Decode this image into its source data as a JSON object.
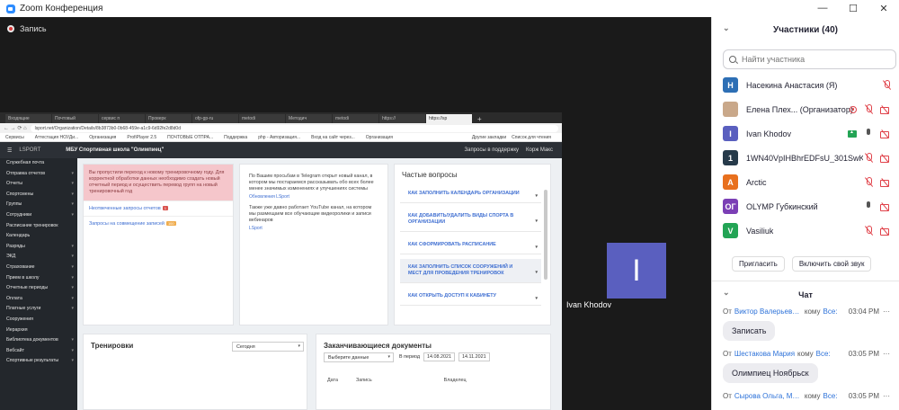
{
  "window": {
    "title": "Zoom Конференция",
    "minimize": "—",
    "maximize": "☐",
    "close": "✕"
  },
  "recording": {
    "label": "Запись"
  },
  "shared_screen": {
    "browser_tabs": [
      "Входящие",
      "Почтовый",
      "сервис п",
      "Проверк",
      "ofp-gp-ru",
      "metodi",
      "Методич",
      "metodi",
      "https://",
      "https://sp"
    ],
    "new_tab": "+",
    "url": "lsport.net/Organization/Details/8b3873b0-0b68-459e-a1c9-6d92fe2d8d0d",
    "bookmarks": [
      "Сервисы",
      "Аттестация НОУДи...",
      "Организация",
      "ProfiPlayer 2.5",
      "ПОЧТОВЫЕ ОТПРА...",
      "Поддержка",
      "php - Авторизация...",
      "Вход на сайт через...",
      "Организация"
    ],
    "bookmarks_right": [
      "Другие закладки",
      "Список для чтения"
    ],
    "app_brand": "LSPORT",
    "org_name": "МБУ Спортивная школа \"Олимпиец\"",
    "app_right": [
      "Запросы в поддержку",
      "Корж Макс"
    ],
    "sidebar": [
      "Служебная почта",
      "Отправка отчетов",
      "Отчеты",
      "Спортсмены",
      "Группы",
      "Сотрудники",
      "Расписание тренировок",
      "Календарь",
      "Разряды",
      "ЭКД",
      "Страхование",
      "Прием в школу",
      "Отчетные периоды",
      "Оплата",
      "Платные услуги",
      "Сооружения",
      "Иерархия",
      "Библиотека документов",
      "Вебсайт",
      "Спортивные результаты"
    ],
    "sidebar_arrows": [
      false,
      true,
      true,
      true,
      true,
      true,
      false,
      false,
      true,
      true,
      true,
      true,
      true,
      true,
      true,
      false,
      false,
      true,
      true,
      true
    ],
    "alert": "Вы пропустили переход к новому тренировочному году. Для корректной обработки данных необходимо создать новый отчетный период и осуществить перевод групп на новый тренировочный год",
    "links": [
      {
        "text": "Неотвеченные запросы отчетов",
        "badge": "1",
        "badge_type": "red"
      },
      {
        "text": "Запросы на совмещение записей",
        "badge": "100",
        "badge_type": "yellow"
      }
    ],
    "news": [
      {
        "text": "По Вашим просьбам в Telegram открыт новый канал, в котором мы постараемся рассказывать обо всех более менее значимых изменениях и улучшениях системы",
        "link": "Обновления LSport"
      },
      {
        "text": "Также уже давно работает YouTube канал, на котором мы размещаем все обучающие видеоролики и записи вебинаров",
        "link": "LSport"
      }
    ],
    "faq_title": "Частые вопросы",
    "faq": [
      "КАК ЗАПОЛНИТЬ КАЛЕНДАРЬ ОРГАНИЗАЦИИ",
      "КАК ДОБАВИТЬ/УДАЛИТЬ ВИДЫ СПОРТА В ОРГАНИЗАЦИИ",
      "КАК СФОРМИРОВАТЬ РАСПИСАНИЕ",
      "КАК ЗАПОЛНИТЬ СПИСОК СООРУЖЕНИЙ И МЕСТ ДЛЯ ПРОВЕДЕНИЯ ТРЕНИРОВОК",
      "КАК ОТКРЫТЬ ДОСТУП К КАБИНЕТУ"
    ],
    "trainings": {
      "title": "Тренировки",
      "select": "Сегодня"
    },
    "documents": {
      "title": "Заканчивающиеся документы",
      "select": "Выберите данные",
      "period_label": "В период",
      "date_from": "14.08.2021",
      "date_to": "14.11.2021",
      "columns": [
        "Дата",
        "Запись",
        "Владелец"
      ]
    }
  },
  "video_tile": {
    "initial": "I",
    "name": "Ivan Khodov"
  },
  "participants_panel": {
    "title": "Участники (40)",
    "collapse": "⌄",
    "search_placeholder": "Найти участника",
    "participants": [
      {
        "initial": "Н",
        "color": "#2d6fb5",
        "name": "Насекина Анастасия (Я)"
      },
      {
        "initial": "",
        "color": "#c9a88a",
        "name": "Елена Плех... (Организатор)"
      },
      {
        "initial": "I",
        "color": "#5a5fbf",
        "name": "Ivan Khodov"
      },
      {
        "initial": "1",
        "color": "#263a4a",
        "name": "1WN40VpIHBhrEDFsU_301SwKg..."
      },
      {
        "initial": "A",
        "color": "#e8701e",
        "name": "Arctic"
      },
      {
        "initial": "ОГ",
        "color": "#7b3fb5",
        "name": "OLYMP Губкинский"
      },
      {
        "initial": "V",
        "color": "#23a455",
        "name": "Vasiliuk"
      }
    ],
    "invite_button": "Пригласить",
    "unmute_button": "Включить свой звук"
  },
  "chat": {
    "title": "Чат",
    "collapse": "⌄",
    "messages": [
      {
        "from_label": "От",
        "sender": "Виктор Валерьевич ...",
        "to_label": "кому",
        "recipient": "Все:",
        "time": "03:04 PM",
        "more": "···",
        "text": "Записать"
      },
      {
        "from_label": "От",
        "sender": "Шестакова Мария",
        "to_label": "кому",
        "recipient": "Все:",
        "time": "03:05 PM",
        "more": "···",
        "text": "Олимпиец Ноябрьск"
      },
      {
        "from_label": "От",
        "sender": "Сырова Ольга, МАУ...",
        "to_label": "кому",
        "recipient": "Все:",
        "time": "03:05 PM",
        "more": "···",
        "text": ""
      }
    ]
  }
}
